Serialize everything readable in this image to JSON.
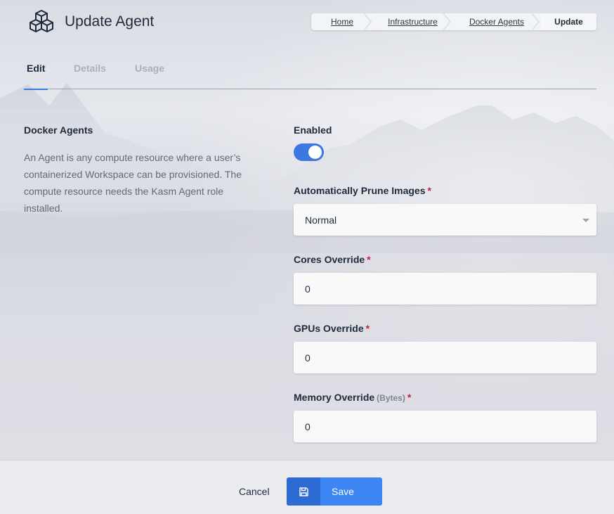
{
  "header": {
    "title": "Update Agent",
    "logo_icon": "cubes-icon"
  },
  "breadcrumb": {
    "items": [
      "Home",
      "Infrastructure",
      "Docker Agents",
      "Update"
    ]
  },
  "tabs": [
    {
      "label": "Edit",
      "active": true
    },
    {
      "label": "Details",
      "active": false
    },
    {
      "label": "Usage",
      "active": false
    }
  ],
  "section": {
    "title": "Docker Agents",
    "description": "An Agent is any compute resource where a user’s containerized Workspace can be provisioned. The compute resource needs the Kasm Agent role installed."
  },
  "form": {
    "enabled": {
      "label": "Enabled",
      "value": true
    },
    "prune": {
      "label": "Automatically Prune Images",
      "required": "*",
      "value": "Normal"
    },
    "cores": {
      "label": "Cores Override",
      "required": "*",
      "value": "0"
    },
    "gpus": {
      "label": "GPUs Override",
      "required": "*",
      "value": "0"
    },
    "memory": {
      "label": "Memory Override",
      "unit": "(Bytes)",
      "required": "*",
      "value": "0"
    }
  },
  "footer": {
    "cancel_label": "Cancel",
    "save_label": "Save",
    "save_icon": "floppy-disk-icon"
  },
  "colors": {
    "accent": "#3c78e0",
    "required": "#c0233f"
  }
}
